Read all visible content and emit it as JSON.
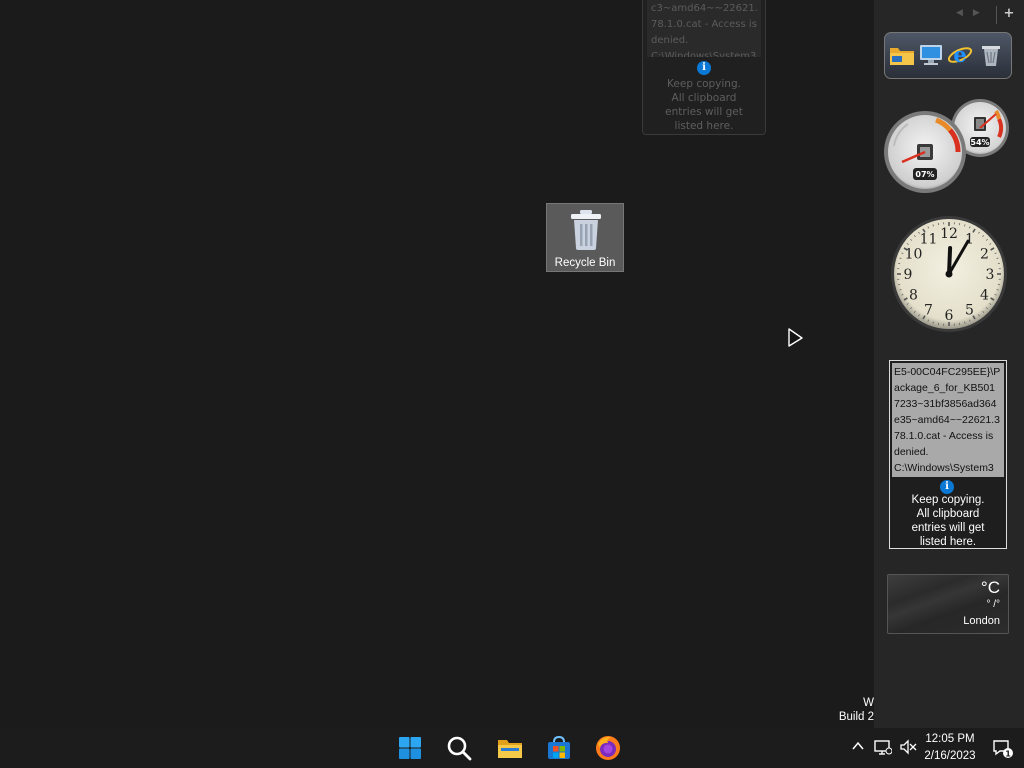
{
  "ghost_clipboard": {
    "lines": [
      "c3~amd64~~22621.",
      "78.1.0.cat - Access is",
      "denied.",
      "C:\\Windows\\System3"
    ],
    "message_lines": [
      "Keep copying.",
      "All clipboard",
      "entries will get",
      "listed here."
    ]
  },
  "desktop": {
    "recycle_bin_label": "Recycle Bin",
    "build_lines": [
      "W",
      "Build 2"
    ]
  },
  "gadget_bar": {
    "nav_prev": "◀",
    "nav_next": "▶",
    "add": "+"
  },
  "launcher": {
    "icons": [
      "folder-icon",
      "computer-icon",
      "internet-explorer-icon",
      "recycle-bin-icon"
    ]
  },
  "cpu_meter": {
    "cpu_label": "07%",
    "memory_label": "54%",
    "cpu_fraction": 0.07,
    "memory_fraction": 0.54
  },
  "clock": {
    "numerals": [
      "12",
      "1",
      "2",
      "3",
      "4",
      "5",
      "6",
      "7",
      "8",
      "9",
      "10",
      "11"
    ],
    "hour": 12,
    "minute": 5
  },
  "clipboard": {
    "lines": [
      "E5-00C04FC295EE}\\P",
      "ackage_6_for_KB501",
      "7233~31bf3856ad364",
      "e35~amd64~~22621.3",
      "78.1.0.cat - Access is",
      "denied.",
      "C:\\Windows\\System3"
    ],
    "info_glyph": "i",
    "message_lines": [
      "Keep copying.",
      "All clipboard",
      "entries will get",
      "listed here."
    ]
  },
  "weather": {
    "unit": "°C",
    "range": "° /°",
    "city": "London"
  },
  "taskbar": {
    "apps": [
      "start-icon",
      "search-icon",
      "file-explorer-icon",
      "store-icon",
      "firefox-icon"
    ],
    "tray_chevron": "^",
    "time": "12:05 PM",
    "date": "2/16/2023",
    "notification_count": "1",
    "accent": "#0a78d4"
  }
}
